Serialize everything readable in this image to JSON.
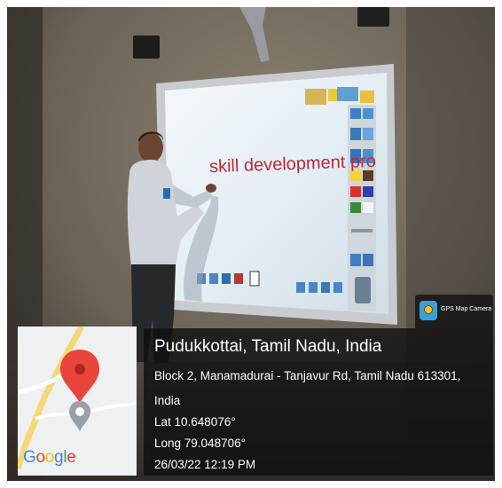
{
  "photo": {
    "board_text": "skill development pro"
  },
  "gps_badge": {
    "label": "GPS Map Camera"
  },
  "map": {
    "brand": "Google",
    "brand_letters": [
      "G",
      "o",
      "o",
      "g",
      "l",
      "e"
    ],
    "brand_colors": [
      "#4285F4",
      "#EA4335",
      "#FBBC05",
      "#4285F4",
      "#34A853",
      "#EA4335"
    ],
    "pin_color": "#E8453C"
  },
  "location": {
    "place": "Pudukkottai, Tamil Nadu, India",
    "address_line_1": "Block 2, Manamadurai - Tanjavur Rd, Tamil Nadu 613301,",
    "address_line_2": "India",
    "latitude": "Lat 10.648076°",
    "longitude": "Long 79.048706°",
    "datetime": "26/03/22 12:19 PM"
  }
}
